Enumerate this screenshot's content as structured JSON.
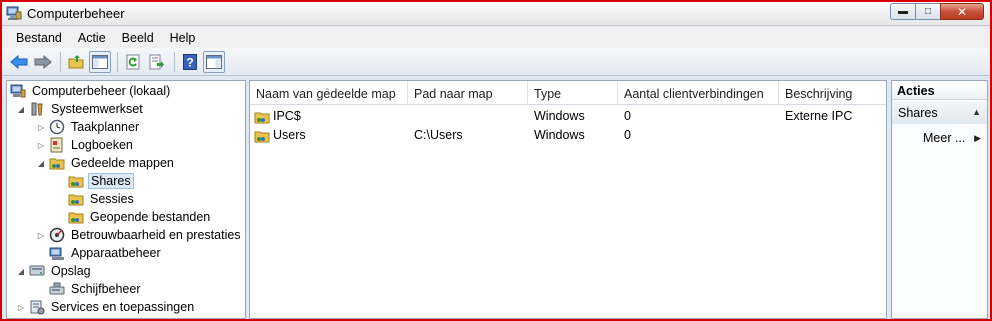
{
  "window": {
    "title": "Computerbeheer"
  },
  "menu": [
    "Bestand",
    "Actie",
    "Beeld",
    "Help"
  ],
  "colors": {
    "accent": "#3a7bd5",
    "selection": "#dceaf8",
    "border_red": "#d80000"
  },
  "tree": [
    {
      "label": "Computerbeheer (lokaal)",
      "icon": "computer-icon",
      "level": 0,
      "twisty": ""
    },
    {
      "label": "Systeemwerkset",
      "icon": "tools-icon",
      "level": 1,
      "twisty": "open"
    },
    {
      "label": "Taakplanner",
      "icon": "clock-icon",
      "level": 2,
      "twisty": "closed"
    },
    {
      "label": "Logboeken",
      "icon": "eventlog-icon",
      "level": 2,
      "twisty": "closed"
    },
    {
      "label": "Gedeelde mappen",
      "icon": "shared-folder-icon",
      "level": 2,
      "twisty": "open"
    },
    {
      "label": "Shares",
      "icon": "shared-folder-icon",
      "level": 3,
      "twisty": "",
      "selected": true
    },
    {
      "label": "Sessies",
      "icon": "shared-folder-icon",
      "level": 3,
      "twisty": ""
    },
    {
      "label": "Geopende bestanden",
      "icon": "shared-folder-icon",
      "level": 3,
      "twisty": ""
    },
    {
      "label": "Betrouwbaarheid en prestaties",
      "icon": "performance-icon",
      "level": 2,
      "twisty": "closed"
    },
    {
      "label": "Apparaatbeheer",
      "icon": "device-manager-icon",
      "level": 2,
      "twisty": ""
    },
    {
      "label": "Opslag",
      "icon": "storage-icon",
      "level": 1,
      "twisty": "open"
    },
    {
      "label": "Schijfbeheer",
      "icon": "disk-icon",
      "level": 2,
      "twisty": ""
    },
    {
      "label": "Services en toepassingen",
      "icon": "services-icon",
      "level": 1,
      "twisty": "closed"
    }
  ],
  "list": {
    "columns": [
      "Naam van gedeelde map",
      "Pad naar map",
      "Type",
      "Aantal clientverbindingen",
      "Beschrijving"
    ],
    "rows": [
      {
        "name": "IPC$",
        "path": "",
        "type": "Windows",
        "connections": "0",
        "description": "Externe IPC"
      },
      {
        "name": "Users",
        "path": "C:\\Users",
        "type": "Windows",
        "connections": "0",
        "description": ""
      }
    ]
  },
  "actions": {
    "title": "Acties",
    "section": "Shares",
    "more": "Meer ..."
  }
}
